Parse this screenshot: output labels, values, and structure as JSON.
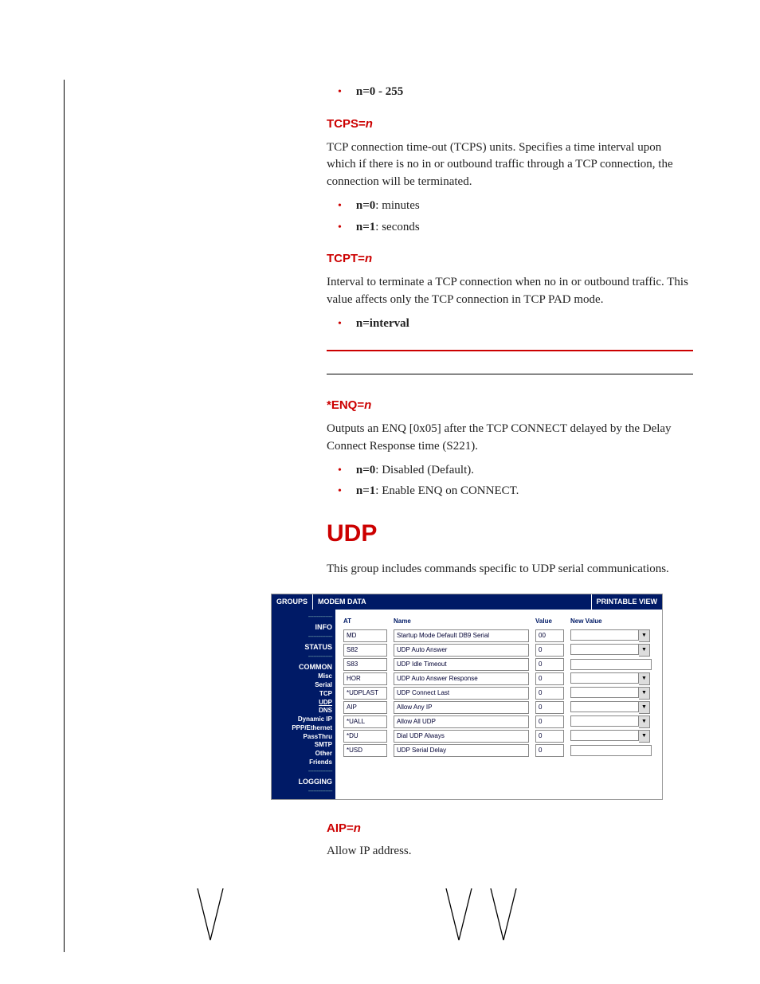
{
  "bullets": {
    "range": "n=0 - 255",
    "tcps0": ": minutes",
    "tcps0b": "n=0",
    "tcps1": ": seconds",
    "tcps1b": "n=1",
    "tcpt": "n=interval",
    "enq0b": "n=0",
    "enq0": ": Disabled (Default).",
    "enq1b": "n=1",
    "enq1": ": Enable ENQ on CONNECT."
  },
  "heads": {
    "tcps": "TCPS=",
    "tcps_v": "n",
    "tcpt": "TCPT=",
    "tcpt_v": "n",
    "enq": "*ENQ=",
    "enq_v": "n",
    "aip": "AIP=",
    "aip_v": "n"
  },
  "paras": {
    "tcps": "TCP connection time-out (TCPS) units. Specifies a time interval upon which if there is no in or outbound traffic through a TCP connection, the connection will be terminated.",
    "tcpt": "Interval to terminate a TCP connection when no in or outbound traffic. This value affects only the TCP connection in TCP PAD mode.",
    "enq": "Outputs an ENQ [0x05] after the TCP CONNECT delayed by the Delay Connect Response time (S221).",
    "udp_h1": "UDP",
    "udp_intro": "This group includes commands specific to UDP serial communications.",
    "aip": "Allow IP address."
  },
  "fig": {
    "top": {
      "groups": "GROUPS",
      "modem": "MODEM DATA",
      "print": "PRINTABLE VIEW"
    },
    "sidebar": {
      "sep": "--------------",
      "info": "INFO",
      "status": "STATUS",
      "common": "COMMON",
      "misc": "Misc",
      "serial": "Serial",
      "tcp": "TCP",
      "udp": "UDP",
      "dns": "DNS",
      "dynip": "Dynamic IP",
      "ppp": "PPP/Ethernet",
      "pass": "PassThru",
      "smtp": "SMTP",
      "other": "Other",
      "friends": "Friends",
      "logging": "LOGGING"
    },
    "thead": {
      "at": "AT",
      "name": "Name",
      "value": "Value",
      "newv": "New Value"
    },
    "rows": [
      {
        "at": "MD",
        "name": "Startup Mode Default DB9 Serial",
        "value": "00",
        "kind": "dd"
      },
      {
        "at": "S82",
        "name": "UDP Auto Answer",
        "value": "0",
        "kind": "dd"
      },
      {
        "at": "S83",
        "name": "UDP Idle Timeout",
        "value": "0",
        "kind": "tb"
      },
      {
        "at": "HOR",
        "name": "UDP Auto Answer Response",
        "value": "0",
        "kind": "dd"
      },
      {
        "at": "*UDPLAST",
        "name": "UDP Connect Last",
        "value": "0",
        "kind": "dd"
      },
      {
        "at": "AIP",
        "name": "Allow Any IP",
        "value": "0",
        "kind": "dd"
      },
      {
        "at": "*UALL",
        "name": "Allow All UDP",
        "value": "0",
        "kind": "dd"
      },
      {
        "at": "*DU",
        "name": "Dial UDP Always",
        "value": "0",
        "kind": "dd"
      },
      {
        "at": "*USD",
        "name": "UDP Serial Delay",
        "value": "0",
        "kind": "tb"
      }
    ]
  }
}
